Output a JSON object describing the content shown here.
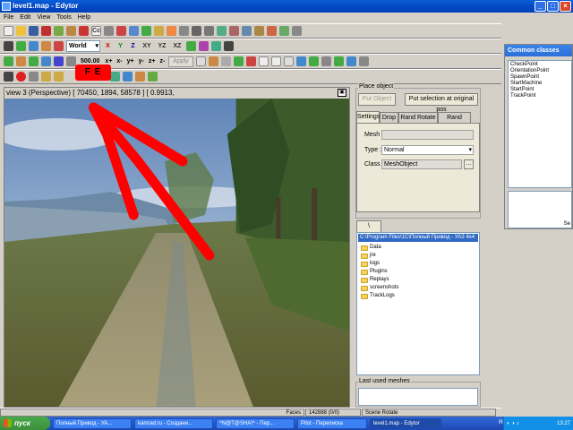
{
  "window": {
    "title": "level1.map - Edytor"
  },
  "menu": [
    "File",
    "Edit",
    "View",
    "Tools",
    "Help"
  ],
  "toolbar": {
    "coord_system": "World",
    "axis_buttons": [
      "X",
      "Y",
      "Z",
      "XY",
      "YZ",
      "XZ"
    ],
    "step_value": "500.00",
    "axis_steps": [
      "x+",
      "x-",
      "y+",
      "y-",
      "z+",
      "z-"
    ],
    "apply_label": "Apply",
    "fe_label": "F E"
  },
  "viewport": {
    "title": "view 3 (Perspective) [ 70450, 1894, 58578 ] [ 0.9913,"
  },
  "place_object": {
    "group_label": "Place object",
    "put_object": "Put Object",
    "put_selection": "Put selection at original pos",
    "tabs": [
      "Settings",
      "Drop",
      "Rand Rotate",
      "Rand Scale"
    ],
    "mesh_label": "Mesh :",
    "mesh_value": "",
    "type_label": "Type :",
    "type_value": "Normal",
    "class_label": "Class :",
    "class_value": "MeshObject",
    "class_browse": "..."
  },
  "files": {
    "tab_label": "\\",
    "path": "C:\\Program Files\\1C\\Полный Привод - УАЗ 4x4",
    "items": [
      "Data",
      "jre",
      "logs",
      "Plugins",
      "Replays",
      "screenshots",
      "TrackLogs"
    ]
  },
  "last_used": {
    "label": "Last used meshes"
  },
  "common_classes": {
    "title": "Common classes",
    "items": [
      "CheckPoint",
      "OrientationPoint",
      "SpawnPoint",
      "StartMachine",
      "StartPoint",
      "TrackPoint"
    ],
    "bottom_label": "Se"
  },
  "status": {
    "faces_label": "Faces",
    "faces_value": "142888 (0/0)",
    "mode": "Scene Rotate"
  },
  "taskbar": {
    "start": "пуск",
    "tasks": [
      "Полный Привод - УА...",
      "kamrad.ru - Создани...",
      "^N@T@SHA!^ - Пер...",
      "Pilot - Переписка",
      "level1.map - Edytor"
    ],
    "lang": "RU",
    "time": "13:27"
  },
  "colors": {
    "titlebar": "#0449c4",
    "annotation": "#ff0000",
    "selection": "#316ac5",
    "face": "#d4d0c8"
  }
}
